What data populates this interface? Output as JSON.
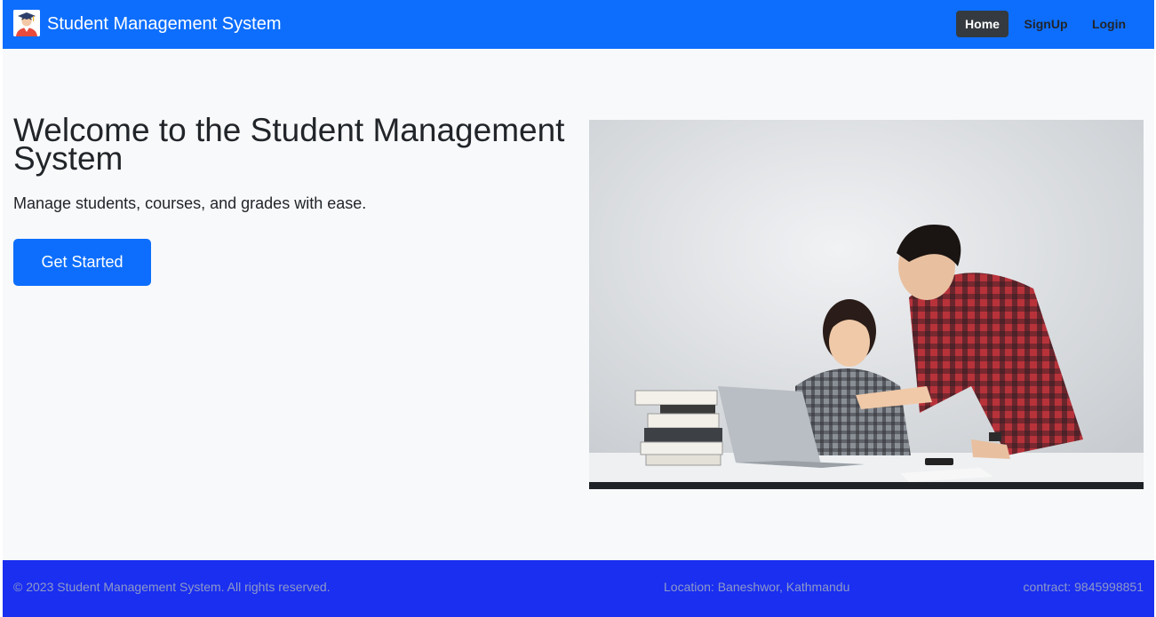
{
  "navbar": {
    "brand_title": "Student Management System",
    "brand_icon": "student-graduate-icon",
    "links": [
      {
        "label": "Home",
        "active": true
      },
      {
        "label": "SignUp",
        "active": false
      },
      {
        "label": "Login",
        "active": false
      }
    ]
  },
  "hero": {
    "title": "Welcome to the Student Management System",
    "subtitle": "Manage students, courses, and grades with ease.",
    "cta_label": "Get Started"
  },
  "footer": {
    "copyright": "© 2023 Student Management System. All rights reserved.",
    "location": "Location: Baneshwor, Kathmandu",
    "contact": "contract: 9845998851"
  },
  "colors": {
    "primary": "#0d6efd",
    "active_nav_bg": "#343a40",
    "footer_bg": "#1a2ff0",
    "page_bg": "#f8f9fa"
  }
}
